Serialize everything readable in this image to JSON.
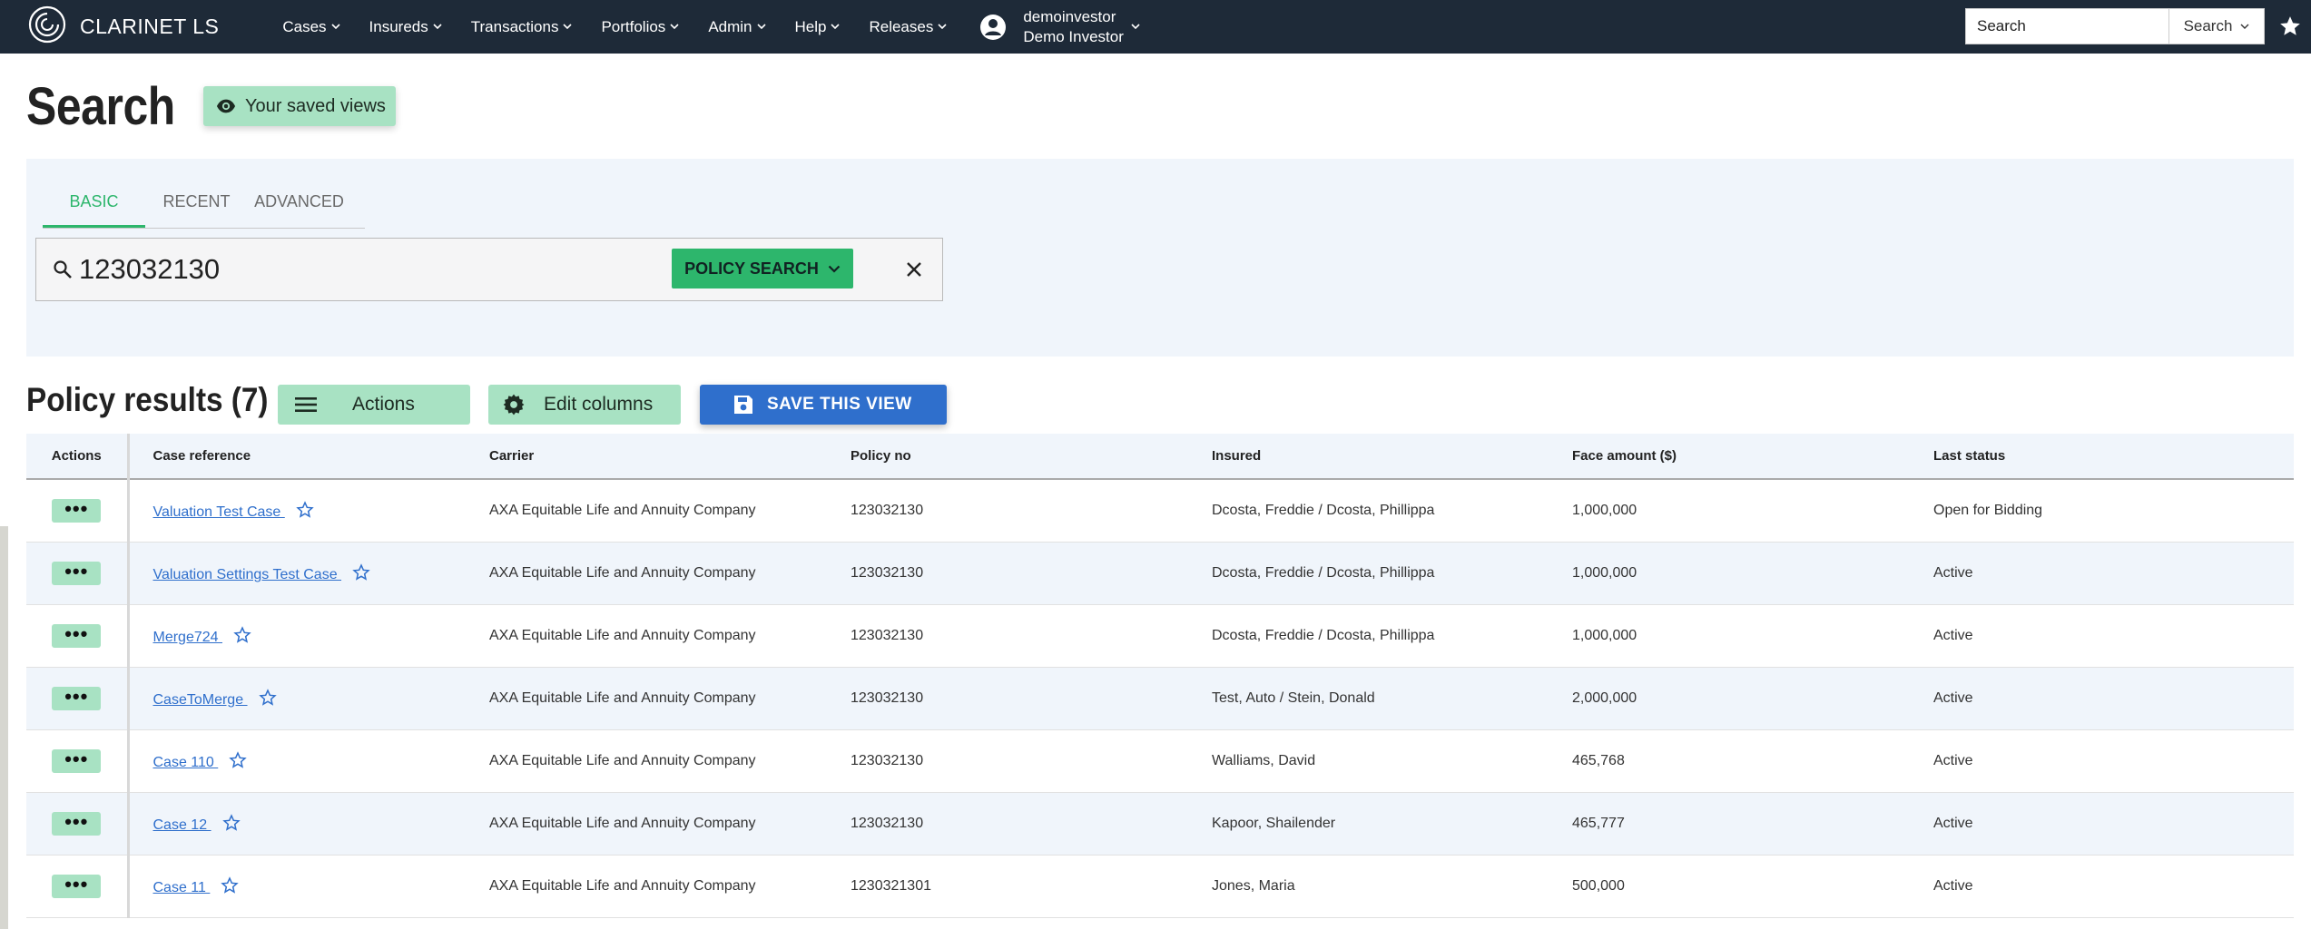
{
  "nav": {
    "brand": "CLARINET LS",
    "menu": [
      {
        "label": "Cases"
      },
      {
        "label": "Insureds"
      },
      {
        "label": "Transactions"
      },
      {
        "label": "Portfolios"
      },
      {
        "label": "Admin"
      },
      {
        "label": "Help"
      },
      {
        "label": "Releases"
      }
    ],
    "user": {
      "username": "demoinvestor",
      "display_name": "Demo Investor"
    },
    "search": {
      "placeholder": "Search",
      "button_label": "Search"
    }
  },
  "page": {
    "title": "Search",
    "saved_views_label": "Your saved views"
  },
  "search": {
    "tabs": [
      {
        "label": "BASIC",
        "active": true
      },
      {
        "label": "RECENT",
        "active": false
      },
      {
        "label": "ADVANCED",
        "active": false
      }
    ],
    "query": "123032130",
    "type_label": "POLICY SEARCH"
  },
  "results": {
    "title": "Policy results (7)",
    "actions_label": "Actions",
    "edit_columns_label": "Edit columns",
    "save_view_label": "SAVE THIS VIEW",
    "columns": [
      "Actions",
      "Case reference",
      "Carrier",
      "Policy no",
      "Insured",
      "Face amount ($)",
      "Last status"
    ],
    "rows": [
      {
        "actions": "•••",
        "case": "Valuation Test Case ",
        "carrier": "AXA Equitable Life and Annuity Company",
        "policy": "123032130",
        "insured": "Dcosta, Freddie / Dcosta, Phillippa",
        "face": "1,000,000",
        "status": "Open for Bidding"
      },
      {
        "actions": "•••",
        "case": "Valuation Settings Test Case ",
        "carrier": "AXA Equitable Life and Annuity Company",
        "policy": "123032130",
        "insured": "Dcosta, Freddie / Dcosta, Phillippa",
        "face": "1,000,000",
        "status": "Active"
      },
      {
        "actions": "•••",
        "case": "Merge724 ",
        "carrier": "AXA Equitable Life and Annuity Company",
        "policy": "123032130",
        "insured": "Dcosta, Freddie / Dcosta, Phillippa",
        "face": "1,000,000",
        "status": "Active"
      },
      {
        "actions": "•••",
        "case": "CaseToMerge ",
        "carrier": "AXA Equitable Life and Annuity Company",
        "policy": "123032130",
        "insured": "Test, Auto / Stein, Donald",
        "face": "2,000,000",
        "status": "Active"
      },
      {
        "actions": "•••",
        "case": "Case 110 ",
        "carrier": "AXA Equitable Life and Annuity Company",
        "policy": "123032130",
        "insured": "Walliams, David",
        "face": "465,768",
        "status": "Active"
      },
      {
        "actions": "•••",
        "case": "Case 12 ",
        "carrier": "AXA Equitable Life and Annuity Company",
        "policy": "123032130",
        "insured": "Kapoor, Shailender",
        "face": "465,777",
        "status": "Active"
      },
      {
        "actions": "•••",
        "case": "Case 11 ",
        "carrier": "AXA Equitable Life and Annuity Company",
        "policy": "1230321301",
        "insured": "Jones, Maria",
        "face": "500,000",
        "status": "Active"
      }
    ]
  },
  "colors": {
    "navbar": "#1e2a38",
    "accent_green": "#2db66c",
    "light_green": "#a8e2c3",
    "primary_blue": "#2f6fcc",
    "panel_bg": "#f0f5fb"
  },
  "icons": {
    "logo": "clarinet-logo-icon",
    "user": "user-circle-icon",
    "star": "star-icon",
    "search": "magnifier-icon",
    "clear": "close-icon",
    "saved_views": "eye-icon",
    "actions": "hamburger-icon",
    "edit_columns": "gear-icon",
    "save": "floppy-disk-icon"
  }
}
